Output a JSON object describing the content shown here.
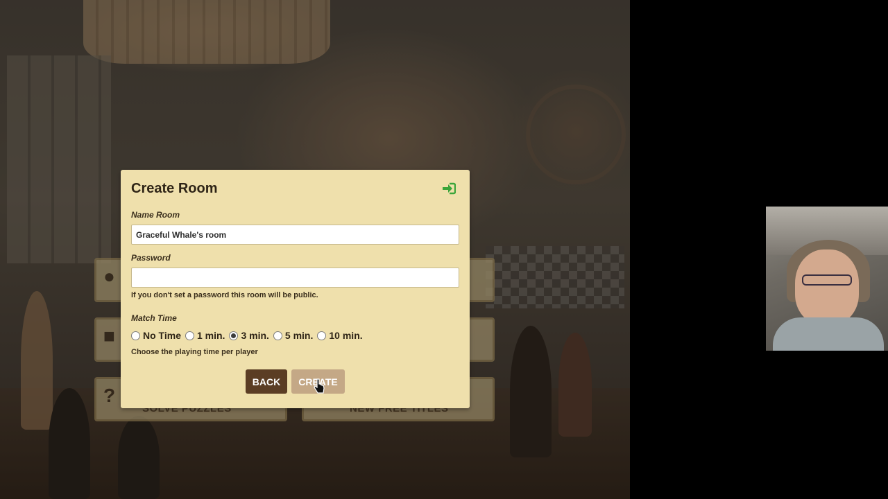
{
  "modal": {
    "title": "Create Room",
    "name_label": "Name Room",
    "name_value": "Graceful Whale's room",
    "password_label": "Password",
    "password_value": "",
    "password_hint": "If you don't set a password this room will be public.",
    "match_time_label": "Match Time",
    "match_time_options": [
      "No Time",
      "1 min.",
      "3 min.",
      "5 min.",
      "10 min."
    ],
    "match_time_selected": "3 min.",
    "match_time_hint": "Choose the playing time per player",
    "back_label": "BACK",
    "create_label": "CREATE",
    "login_icon": "sign-in-icon"
  },
  "menu": {
    "puzzles_label": "SOLVE PUZZLES",
    "titles_label": "NEW FREE TITLES"
  },
  "colors": {
    "modal_bg": "#efe0ac",
    "back_button": "#5b3d24",
    "create_button": "#c4a886",
    "login_icon": "#3aa53a"
  }
}
